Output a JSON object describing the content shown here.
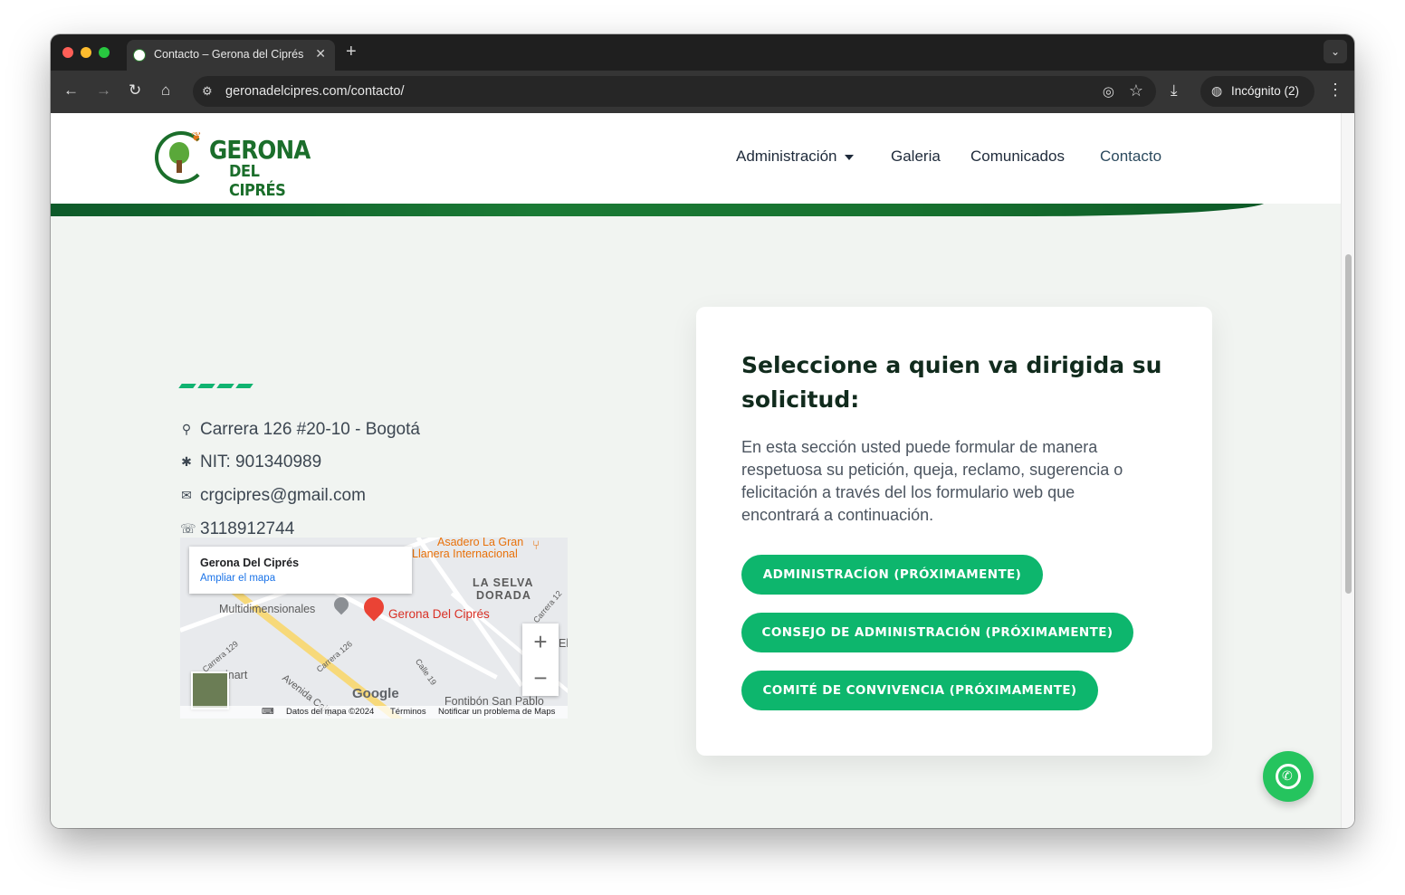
{
  "browser": {
    "tab_title": "Contacto – Gerona del Ciprés",
    "tab_close": "✕",
    "new_tab": "+",
    "tab_menu": "⌄",
    "back": "←",
    "forward": "→",
    "reload": "↻",
    "home": "⌂",
    "url": "geronadelcipres.com/contacto/",
    "incognito_label": "Incógnito (2)",
    "icons": [
      "site-info-icon",
      "eye-off-icon",
      "star-icon",
      "download-icon",
      "incognito-icon",
      "more-menu-icon"
    ]
  },
  "header": {
    "logo_line1": "GERONA",
    "logo_line2": "DEL CIPRÉS",
    "nav": [
      {
        "label": "Administración",
        "has_dropdown": true
      },
      {
        "label": "Galeria"
      },
      {
        "label": "Comunicados"
      },
      {
        "label": "Contacto",
        "active": true
      }
    ]
  },
  "contact_info": {
    "address": "Carrera 126 #20-10 - Bogotá",
    "nit": "NIT: 901340989",
    "email": "crgcipres@gmail.com",
    "phone": "3118912744"
  },
  "map": {
    "place_name": "Gerona Del Ciprés",
    "expand_link": "Ampliar el mapa",
    "marker_label": "Gerona Del Ciprés",
    "labels": {
      "restaurant": "Asadero La Gran",
      "restaurant2": "Llanera Internacional",
      "neighborhood1": "LA SELVA",
      "neighborhood2": "DORADA",
      "poi_multi": "Multidimensionales",
      "poi_inart": "inart",
      "poi_fontibon": "Fontibón San Pablo",
      "street_avenida": "Avenida Calle",
      "street_c129": "Carrera 129",
      "street_c126": "Carrera 126",
      "street_calle19": "Calle 19",
      "street_c12": "Carrera 12",
      "cutoff_el": "El"
    },
    "zoom_in": "+",
    "zoom_out": "−",
    "google_logo": "Google",
    "attribution_data": "Datos del mapa ©2024",
    "attribution_terms": "Términos",
    "attribution_report": "Notificar un problema de Maps"
  },
  "request_card": {
    "heading": "Seleccione a quien va dirigida su solicitud:",
    "description": "En esta sección usted puede formular de manera respetuosa su petición, queja, reclamo, sugerencia o felicitación a través del los formulario web que encontrará a continuación.",
    "buttons": [
      "ADMINISTRACÍON (PRÓXIMAMENTE)",
      "CONSEJO DE ADMINISTRACIÓN (PRÓXIMAMENTE)",
      "COMITÉ DE CONVIVENCIA (PRÓXIMAMENTE)"
    ]
  },
  "colors": {
    "accent_green": "#0db66d",
    "brand_dark_green": "#1b6e2b",
    "heading": "#112b1d",
    "page_bg": "#f1f4f1"
  }
}
